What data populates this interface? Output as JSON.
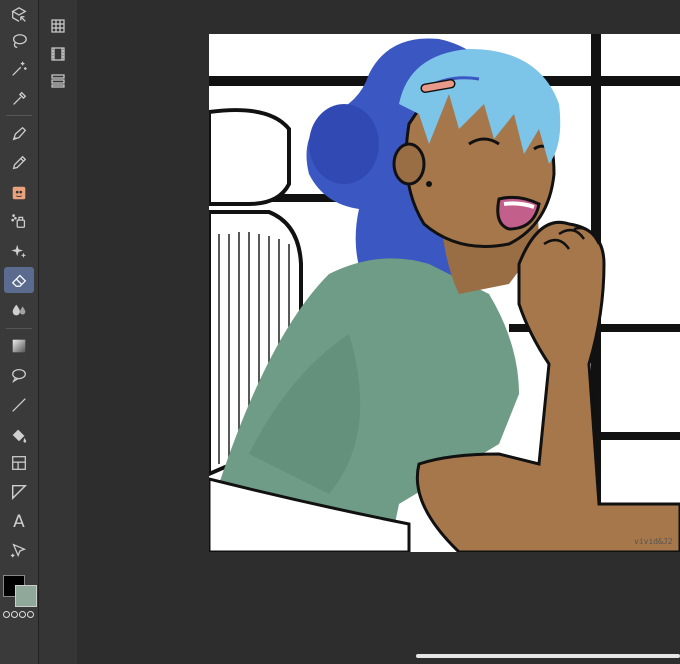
{
  "toolbar": {
    "tools": [
      {
        "id": "move",
        "icon": "move-layer-icon"
      },
      {
        "id": "lasso",
        "icon": "lasso-icon"
      },
      {
        "id": "magic",
        "icon": "magic-wand-icon"
      },
      {
        "id": "eyedropper",
        "icon": "eyedropper-icon"
      },
      {
        "id": "pen",
        "icon": "pen-icon"
      },
      {
        "id": "pencil",
        "icon": "pencil-icon"
      },
      {
        "id": "brush",
        "icon": "brush-icon"
      },
      {
        "id": "airbrush",
        "icon": "airbrush-icon"
      },
      {
        "id": "decoration",
        "icon": "sparkle-icon"
      },
      {
        "id": "eraser",
        "icon": "eraser-icon",
        "active": true
      },
      {
        "id": "blend",
        "icon": "blend-drop-icon"
      },
      {
        "id": "gradient",
        "icon": "gradient-icon"
      },
      {
        "id": "balloon",
        "icon": "speech-balloon-icon"
      },
      {
        "id": "line",
        "icon": "line-icon"
      },
      {
        "id": "fill",
        "icon": "fill-bucket-icon"
      },
      {
        "id": "frame",
        "icon": "frame-border-icon"
      },
      {
        "id": "ruler",
        "icon": "ruler-icon"
      },
      {
        "id": "text",
        "icon": "text-icon",
        "label": "A"
      },
      {
        "id": "operation",
        "icon": "operation-icon"
      }
    ],
    "colors": {
      "foreground": "#000000",
      "background": "#8fa89a"
    }
  },
  "subbar": {
    "items": [
      {
        "icon": "layer-properties-icon"
      },
      {
        "icon": "animation-icon"
      },
      {
        "icon": "layers-list-icon"
      }
    ]
  },
  "canvas": {
    "signature": "vivid&J2"
  }
}
